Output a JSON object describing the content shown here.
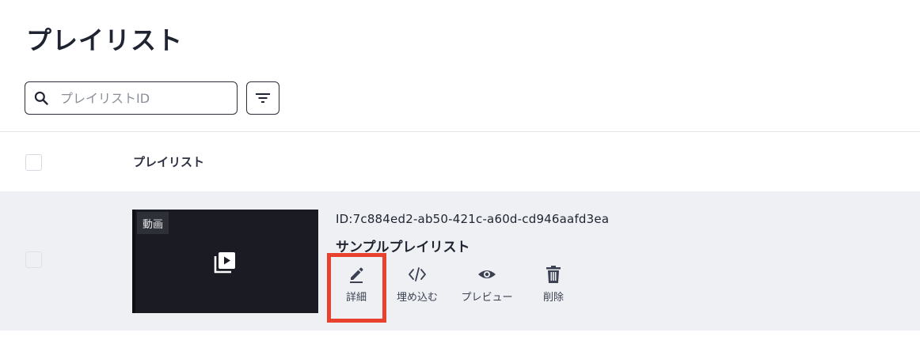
{
  "page": {
    "title": "プレイリスト"
  },
  "search": {
    "placeholder": "プレイリストID",
    "value": ""
  },
  "table": {
    "header": "プレイリスト",
    "rows": [
      {
        "thumbnail_tag": "動画",
        "id_text": "ID:7c884ed2-ab50-421c-a60d-cd946aafd3ea",
        "name": "サンプルプレイリスト",
        "actions": [
          {
            "label": "詳細",
            "icon": "pencil-icon"
          },
          {
            "label": "埋め込む",
            "icon": "code-icon"
          },
          {
            "label": "プレビュー",
            "icon": "eye-icon"
          },
          {
            "label": "削除",
            "icon": "trash-icon"
          }
        ]
      }
    ]
  },
  "colors": {
    "highlight": "#e8412e",
    "row_bg": "#eef0f4",
    "text": "#1f2430"
  }
}
